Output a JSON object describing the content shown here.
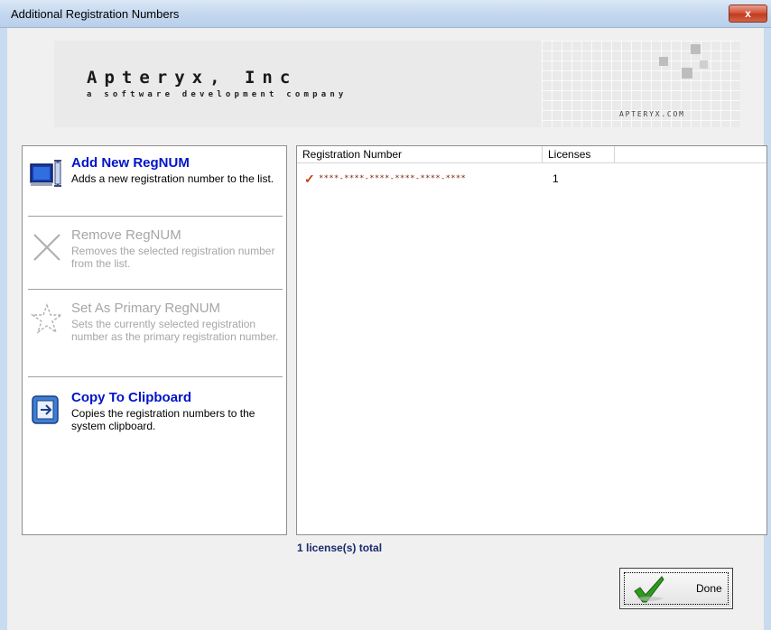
{
  "window": {
    "title": "Additional Registration Numbers",
    "close_symbol": "x"
  },
  "banner": {
    "company": "Apteryx, Inc",
    "tagline": "a software development company",
    "site": "APTERYX.COM"
  },
  "actions": [
    {
      "name": "Add New RegNUM",
      "description": "Adds a new registration number to the list.",
      "enabled": true,
      "icon": "monitor-add-icon"
    },
    {
      "name": "Remove RegNUM",
      "description": "Removes the selected registration number from the list.",
      "enabled": false,
      "icon": "x-remove-icon"
    },
    {
      "name": "Set As Primary RegNUM",
      "description": "Sets the currently selected registration number as the primary registration number.",
      "enabled": false,
      "icon": "star-outline-icon"
    },
    {
      "name": "Copy To Clipboard",
      "description": "Copies the registration numbers to the system clipboard.",
      "enabled": true,
      "icon": "clipboard-icon"
    }
  ],
  "list": {
    "columns": [
      "Registration Number",
      "Licenses"
    ],
    "rows": [
      {
        "check": "✓",
        "reg_number": "****-****-****-****-****-****",
        "licenses": "1"
      }
    ]
  },
  "summary": {
    "total": "1 license(s) total"
  },
  "buttons": {
    "done_label": "Done"
  },
  "colors": {
    "action_enabled": "#0014c8",
    "action_disabled": "#a6a6a6",
    "check": "#c0401b",
    "done_check": "#2e9a1e"
  }
}
